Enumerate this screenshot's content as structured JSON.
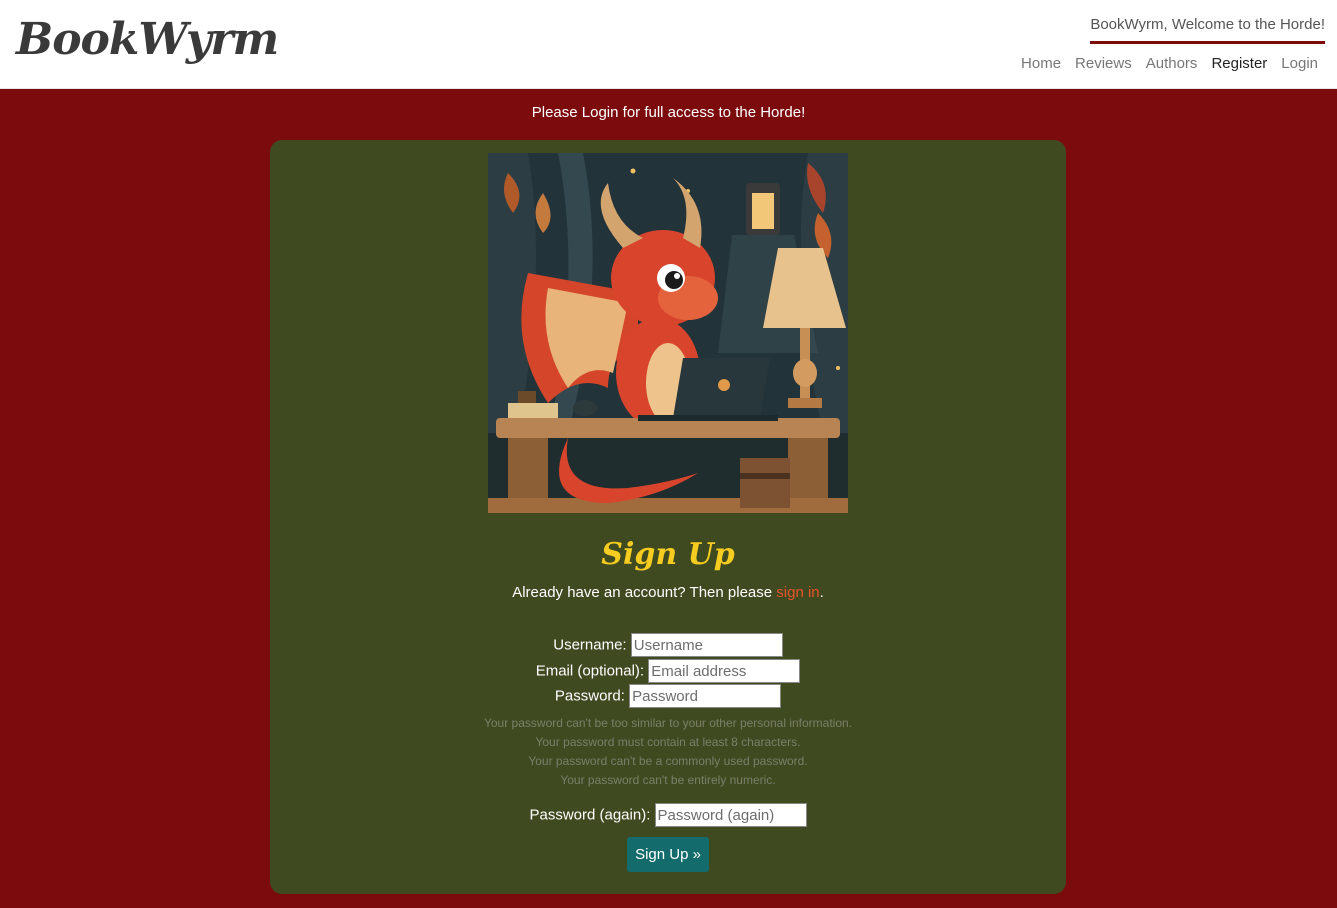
{
  "header": {
    "brand": "BookWyrm",
    "welcome": "BookWyrm, Welcome to the Horde!",
    "nav": [
      {
        "label": "Home",
        "active": false
      },
      {
        "label": "Reviews",
        "active": false
      },
      {
        "label": "Authors",
        "active": false
      },
      {
        "label": "Register",
        "active": true
      },
      {
        "label": "Login",
        "active": false
      }
    ]
  },
  "notice": "Please Login for full access to the Horde!",
  "signup": {
    "title": "Sign Up",
    "already_text": "Already have an account? Then please ",
    "sign_in_link": "sign in",
    "already_end": ".",
    "username_label": "Username:",
    "username_placeholder": "Username",
    "email_label": "Email (optional):",
    "email_placeholder": "Email address",
    "password_label": "Password:",
    "password_placeholder": "Password",
    "password_help": [
      "Your password can't be too similar to your other personal information.",
      "Your password must contain at least 8 characters.",
      "Your password can't be a commonly used password.",
      "Your password can't be entirely numeric."
    ],
    "password2_label": "Password (again):",
    "password2_placeholder": "Password (again)",
    "submit_label": "Sign Up »"
  },
  "colors": {
    "page_background": "#7c0b0e",
    "card_background": "#404a20",
    "title": "#f5cc1f",
    "link": "#e8532a",
    "button": "#136b6c"
  },
  "icons": {
    "hero_image": "dragon-at-laptop-illustration"
  }
}
